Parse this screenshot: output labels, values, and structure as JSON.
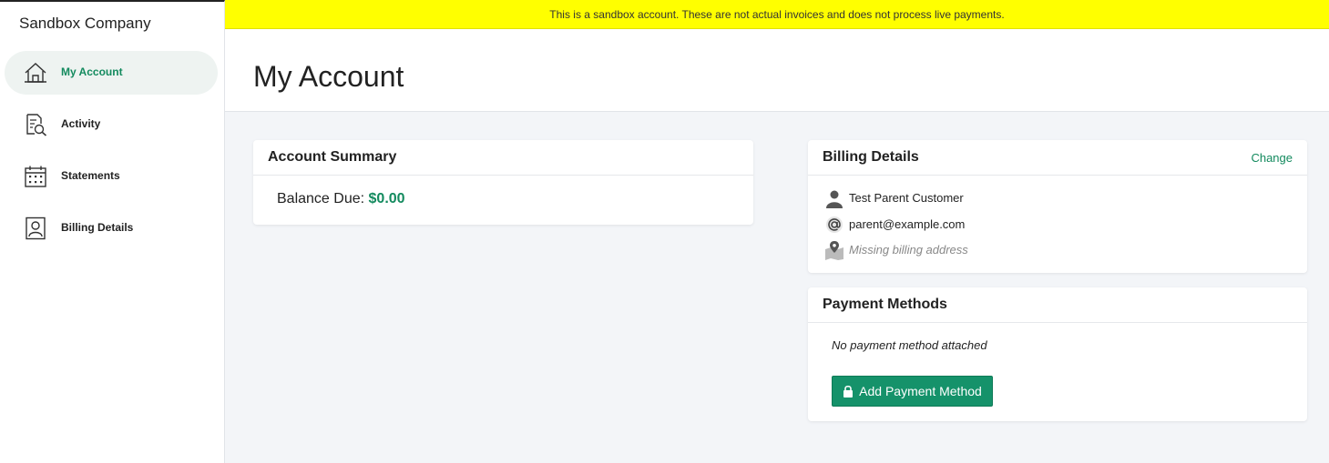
{
  "sidebar": {
    "company": "Sandbox Company",
    "items": [
      {
        "label": "My Account",
        "icon": "home-icon"
      },
      {
        "label": "Activity",
        "icon": "document-search-icon"
      },
      {
        "label": "Statements",
        "icon": "calendar-icon"
      },
      {
        "label": "Billing Details",
        "icon": "user-badge-icon"
      }
    ]
  },
  "banner": {
    "text": "This is a sandbox account. These are not actual invoices and does not process live payments."
  },
  "header": {
    "title": "My Account"
  },
  "account_summary": {
    "title": "Account Summary",
    "balance_label": "Balance Due:",
    "balance_value": "$0.00"
  },
  "billing_details": {
    "title": "Billing Details",
    "change_label": "Change",
    "name": "Test Parent Customer",
    "email": "parent@example.com",
    "address": "Missing billing address"
  },
  "payment_methods": {
    "title": "Payment Methods",
    "empty_text": "No payment method attached",
    "add_label": "Add Payment Method"
  },
  "colors": {
    "accent": "#138a5e",
    "banner": "#ffff00",
    "button": "#15926a"
  }
}
